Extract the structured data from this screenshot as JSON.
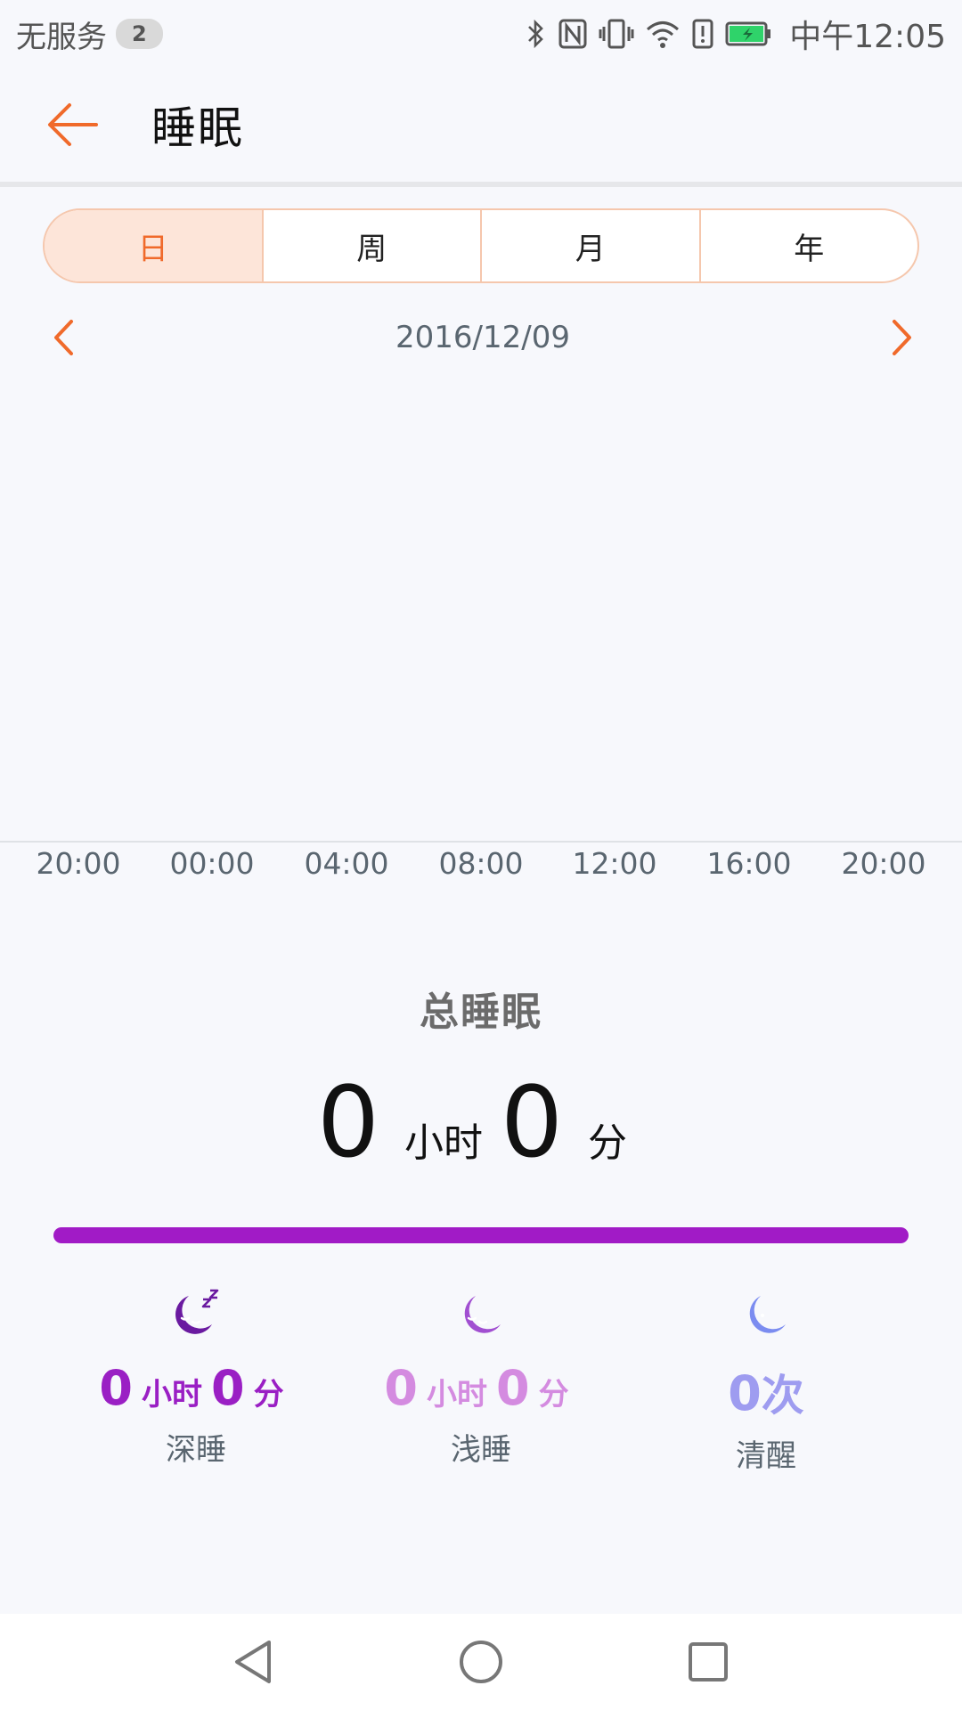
{
  "status_bar": {
    "carrier": "无服务",
    "sim_badge": "2",
    "time": "中午12:05",
    "icons": [
      "bluetooth-icon",
      "nfc-icon",
      "vibrate-icon",
      "wifi-icon",
      "alert-icon",
      "battery-charging-icon"
    ]
  },
  "header": {
    "title": "睡眠",
    "back_icon": "arrow-left-icon"
  },
  "tabs": [
    {
      "label": "日",
      "active": true
    },
    {
      "label": "周",
      "active": false
    },
    {
      "label": "月",
      "active": false
    },
    {
      "label": "年",
      "active": false
    }
  ],
  "date_nav": {
    "date": "2016/12/09",
    "prev_icon": "chevron-left-icon",
    "next_icon": "chevron-right-icon"
  },
  "chart_data": {
    "type": "bar",
    "x_ticks": [
      "20:00",
      "00:00",
      "04:00",
      "08:00",
      "12:00",
      "16:00",
      "20:00"
    ],
    "series": []
  },
  "summary": {
    "title": "总睡眠",
    "hours": "0",
    "hours_unit": "小时",
    "minutes": "0",
    "minutes_unit": "分",
    "bar_color": "#a11bc6"
  },
  "stats": [
    {
      "icon": "moon-zzz-icon",
      "color": "#9a1fc4",
      "hours": "0",
      "hours_unit": "小时",
      "minutes": "0",
      "minutes_unit": "分",
      "label": "深睡"
    },
    {
      "icon": "moon-sleep-icon",
      "color": "#d48be0",
      "hours": "0",
      "hours_unit": "小时",
      "minutes": "0",
      "minutes_unit": "分",
      "label": "浅睡"
    },
    {
      "icon": "moon-icon",
      "color": "#9e9cf0",
      "count": "0",
      "count_unit": "次",
      "label": "清醒"
    }
  ],
  "accent_color": "#f06a2b"
}
